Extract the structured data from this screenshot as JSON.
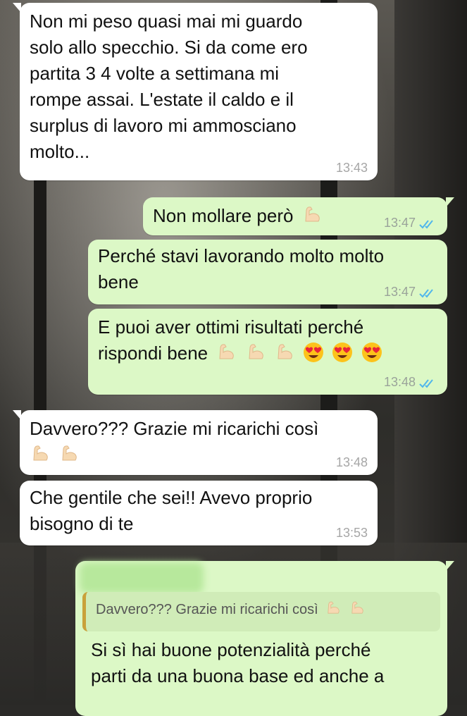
{
  "messages": [
    {
      "id": "m1",
      "dir": "in",
      "lines": [
        "Non mi peso quasi mai mi guardo",
        "solo allo specchio. Si da come ero",
        "partita 3 4 volte a settimana mi",
        "rompe assai. L'estate il caldo e il",
        "surplus di lavoro mi ammosciano",
        "molto..."
      ],
      "time": "13:43"
    },
    {
      "id": "m2",
      "dir": "out",
      "text": "Non mollare però",
      "emoji": [
        "flexed-biceps"
      ],
      "time": "13:47",
      "read": true
    },
    {
      "id": "m3",
      "dir": "out",
      "lines": [
        "Perché stavi lavorando molto molto",
        "bene"
      ],
      "time": "13:47",
      "read": true
    },
    {
      "id": "m4",
      "dir": "out",
      "line1": "E puoi aver ottimi risultati perché",
      "line2": "rispondi bene",
      "emoji": [
        "flexed-biceps",
        "flexed-biceps",
        "flexed-biceps",
        "heart-eyes",
        "heart-eyes",
        "heart-eyes"
      ],
      "time": "13:48",
      "read": true
    },
    {
      "id": "m5",
      "dir": "in",
      "text": "Davvero??? Grazie mi ricarichi così",
      "emoji": [
        "flexed-biceps",
        "flexed-biceps"
      ],
      "time": "13:48"
    },
    {
      "id": "m6",
      "dir": "in",
      "lines": [
        "Che gentile che sei!! Avevo proprio",
        "bisogno di te"
      ],
      "time": "13:53"
    },
    {
      "id": "m7",
      "dir": "out",
      "quoted": "Davvero??? Grazie mi ricarichi così",
      "quoted_emoji": [
        "flexed-biceps",
        "flexed-biceps"
      ],
      "lines": [
        "Si sì hai buone potenzialità perché",
        "parti da una buona base ed anche a"
      ]
    }
  ],
  "colors": {
    "incoming": "#ffffff",
    "outgoing": "#dcf8c6",
    "read_ticks": "#4fb6ec",
    "quote_bar": "#c9a13a"
  }
}
